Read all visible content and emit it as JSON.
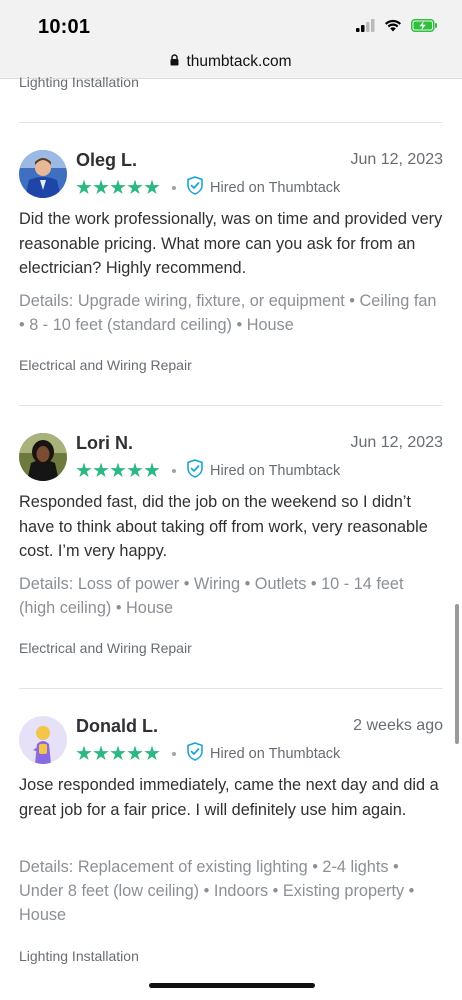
{
  "status_bar": {
    "time": "10:01"
  },
  "browser": {
    "url": "thumbtack.com"
  },
  "previous_category": "Lighting Installation",
  "reviews": [
    {
      "name": "Oleg L.",
      "date": "Jun 12, 2023",
      "rating": 5,
      "hired_label": "Hired on Thumbtack",
      "text": "Did the work professionally, was on time and provided very reasonable pricing. What more can you ask for from an electrician? Highly recommend.",
      "details": "Details: Upgrade wiring, fixture, or equipment • Ceiling fan • 8 - 10 feet (standard ceiling) • House",
      "category": "Electrical and Wiring Repair"
    },
    {
      "name": "Lori N.",
      "date": "Jun 12, 2023",
      "rating": 5,
      "hired_label": "Hired on Thumbtack",
      "text": "Responded fast, did the job on the weekend so I didn’t have to think about taking off from work, very reasonable cost. I’m very happy.",
      "details": "Details: Loss of power • Wiring • Outlets • 10 - 14 feet (high ceiling) • House",
      "category": "Electrical and Wiring Repair"
    },
    {
      "name": "Donald L.",
      "date": "2 weeks ago",
      "rating": 5,
      "hired_label": "Hired on Thumbtack",
      "text": "Jose responded immediately, came the next day and did a great job for a fair price. I will definitely use him again.",
      "details": "Details: Replacement of existing lighting • 2-4 lights • Under 8 feet (low ceiling) • Indoors • Existing property • House",
      "category": "Lighting Installation"
    }
  ],
  "colors": {
    "star": "#2db783",
    "verified": "#1aa4d6",
    "text": "#2f3033",
    "muted": "#676d73"
  }
}
